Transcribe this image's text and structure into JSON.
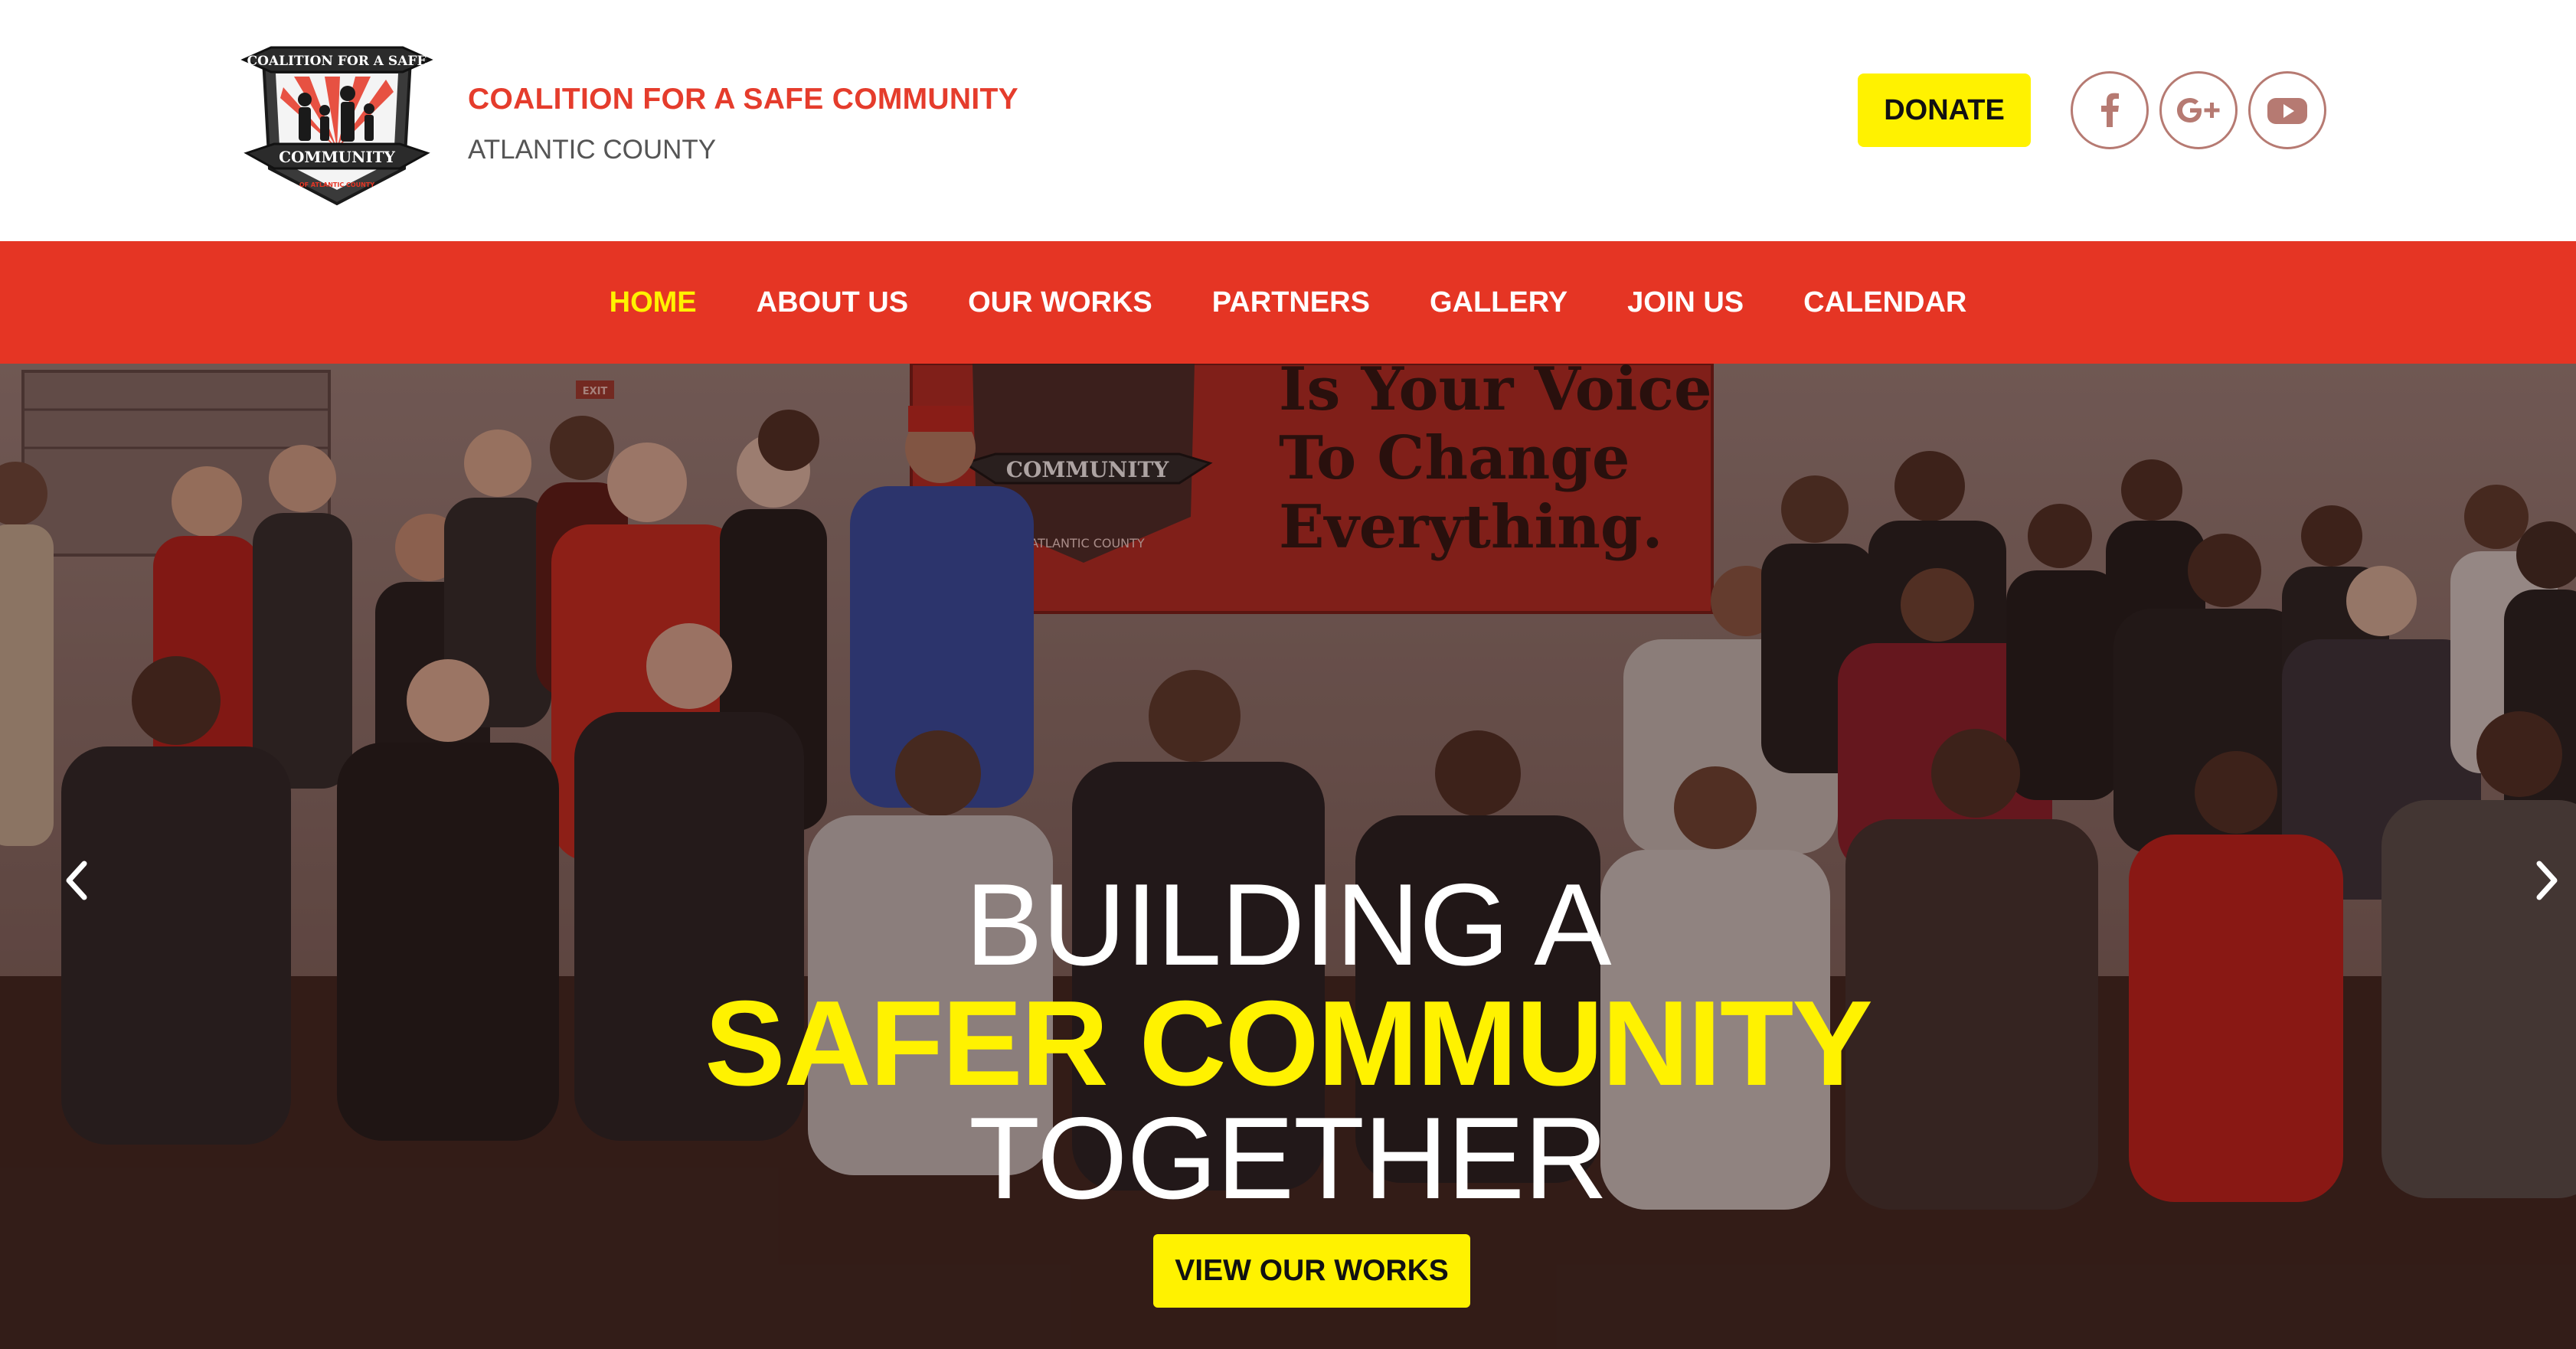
{
  "header": {
    "logo": {
      "top_text": "COALITION FOR A SAFE",
      "bottom_text": "COMMUNITY",
      "tag_text": "OF ATLANTIC COUNTY"
    },
    "brand_name": "COALITION FOR A SAFE COMMUNITY",
    "brand_sub": "ATLANTIC COUNTY",
    "donate_label": "DONATE",
    "social": [
      {
        "name": "facebook",
        "icon": "facebook-icon"
      },
      {
        "name": "google-plus",
        "icon": "google-plus-icon"
      },
      {
        "name": "youtube",
        "icon": "youtube-icon"
      }
    ]
  },
  "nav": {
    "items": [
      {
        "label": "HOME",
        "active": true
      },
      {
        "label": "ABOUT US",
        "active": false
      },
      {
        "label": "OUR WORKS",
        "active": false
      },
      {
        "label": "PARTNERS",
        "active": false
      },
      {
        "label": "GALLERY",
        "active": false
      },
      {
        "label": "JOIN US",
        "active": false
      },
      {
        "label": "CALENDAR",
        "active": false
      }
    ]
  },
  "hero": {
    "banner": {
      "logo_text": "COMMUNITY",
      "logo_sub": "ATLANTIC COUNTY",
      "lines": [
        "Is Your Voice",
        "To Change",
        "Everything."
      ]
    },
    "exit_sign": "EXIT",
    "headline_line1": "BUILDING A",
    "headline_line2": "SAFER COMMUNITY",
    "headline_line3": "TOGETHER",
    "cta_label": "VIEW OUR WORKS"
  },
  "colors": {
    "brand_red": "#e53524",
    "accent_yellow": "#fff200",
    "social_ring": "#b67a72"
  }
}
